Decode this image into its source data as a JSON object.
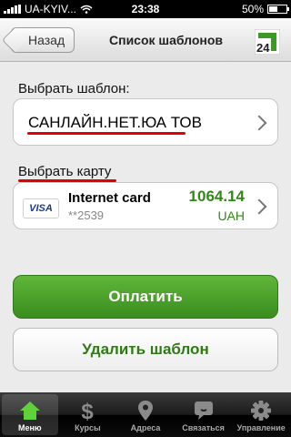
{
  "status": {
    "carrier": "UA-KYIV...",
    "time": "23:38",
    "battery": "50%",
    "battery_fraction": 0.5
  },
  "nav": {
    "back_label": "Назад",
    "title": "Список шаблонов",
    "logo_text": "24"
  },
  "template_section": {
    "label": "Выбрать шаблон:",
    "value": "САНЛАЙН.НЕТ.ЮА ТОВ"
  },
  "card_section": {
    "label": "Выбрать карту",
    "card_brand": "VISA",
    "card_name": "Internet card",
    "card_number": "**2539",
    "amount": "1064.14",
    "currency": "UAH"
  },
  "buttons": {
    "pay": "Оплатить",
    "delete": "Удалить шаблон"
  },
  "tabs": [
    {
      "label": "Меню",
      "icon": "home-icon",
      "active": true
    },
    {
      "label": "Курсы",
      "icon": "dollar-icon",
      "active": false
    },
    {
      "label": "Адреса",
      "icon": "location-pin-icon",
      "active": false
    },
    {
      "label": "Связаться",
      "icon": "chat-icon",
      "active": false
    },
    {
      "label": "Управление",
      "icon": "gear-icon",
      "active": false
    }
  ],
  "colors": {
    "accent_green": "#3a8d1e",
    "amount_green": "#2f8a14",
    "underline_red": "#e20000"
  }
}
